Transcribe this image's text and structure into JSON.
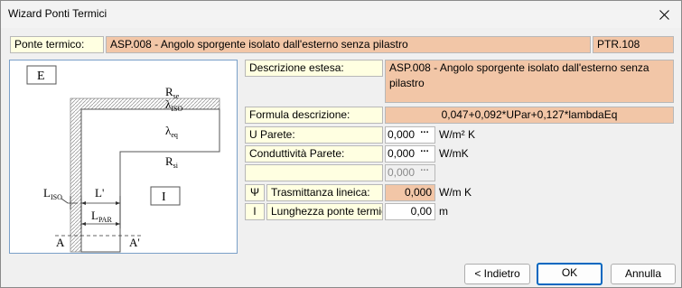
{
  "window": {
    "title": "Wizard Ponti Termici"
  },
  "header": {
    "label": "Ponte termico:",
    "description": "ASP.008 - Angolo sporgente isolato dall'esterno senza pilastro",
    "code": "PTR.108"
  },
  "diagram": {
    "labels": {
      "E": "E",
      "I": "I",
      "Rse": "R",
      "Rse_sub": "se",
      "liso": "λ",
      "liso_sub": "ISO",
      "leq": "λ",
      "leq_sub": "eq",
      "Rsi": "R",
      "Rsi_sub": "si",
      "Liso": "L",
      "Liso_sub": "ISO",
      "Lprime": "L'",
      "Lpar": "L",
      "Lpar_sub": "PAR",
      "A": "A",
      "Aprime": "A'"
    }
  },
  "form": {
    "extended_label": "Descrizione estesa:",
    "extended_value": "ASP.008 - Angolo sporgente isolato dall'esterno senza pilastro",
    "formula_label": "Formula descrizione:",
    "formula_value": "0,047+0,092*UPar+0,127*lambdaEq",
    "u_label": "U Parete:",
    "u_value": "0,000",
    "u_unit": "W/m² K",
    "cond_label": "Conduttività Parete:",
    "cond_value": "0,000",
    "cond_unit": "W/mK",
    "empty_label": "",
    "empty_value": "0,000",
    "psi_symbol": "Ψ",
    "psi_label": "Trasmittanza lineica:",
    "psi_value": "0,000",
    "psi_unit": "W/m K",
    "l_symbol": "l",
    "l_label": "Lunghezza ponte termico:",
    "l_value": "0,00",
    "l_unit": "m",
    "dots": "···"
  },
  "buttons": {
    "back": "< Indietro",
    "ok": "OK",
    "cancel": "Annulla"
  }
}
